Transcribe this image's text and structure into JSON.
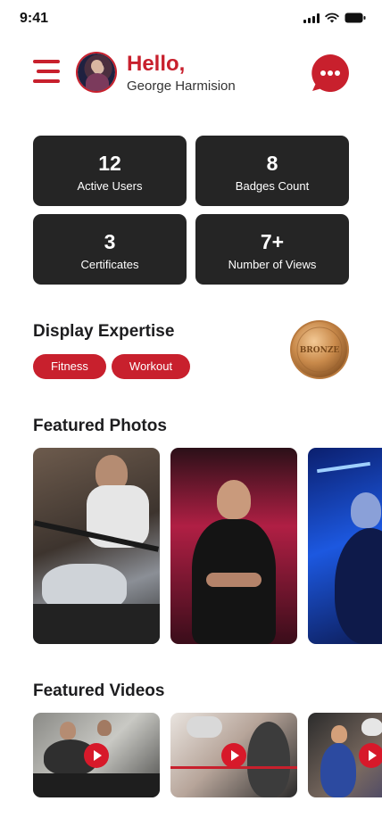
{
  "status_bar": {
    "time": "9:41"
  },
  "header": {
    "greeting": "Hello,",
    "user_name": "George Harmision"
  },
  "stats": [
    {
      "value": "12",
      "label": "Active Users"
    },
    {
      "value": "8",
      "label": "Badges Count"
    },
    {
      "value": "3",
      "label": "Certificates"
    },
    {
      "value": "7+",
      "label": "Number of Views"
    }
  ],
  "expertise": {
    "title": "Display Expertise",
    "tags": [
      "Fitness",
      "Workout"
    ],
    "badge_text": "BRONZE"
  },
  "photos": {
    "title": "Featured Photos"
  },
  "videos": {
    "title": "Featured Videos"
  },
  "colors": {
    "accent": "#c8202d",
    "card": "#252525",
    "bronze": "#c98a4b"
  },
  "icons": [
    "menu-icon",
    "chat-bubble-icon",
    "signal-icon",
    "wifi-icon",
    "battery-icon",
    "play-icon"
  ]
}
